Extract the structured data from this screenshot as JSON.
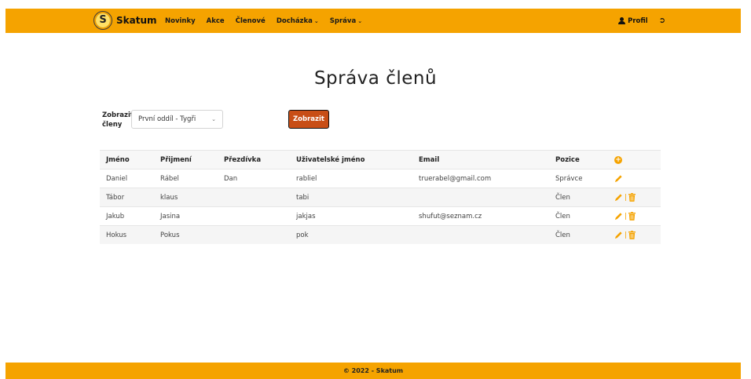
{
  "nav": {
    "brand_letter": "S",
    "brand_name": "Skatum",
    "links": [
      "Novinky",
      "Akce",
      "Členové"
    ],
    "dropdowns": [
      "Docházka",
      "Správa"
    ],
    "profile": "Profil"
  },
  "title": "Správa členů",
  "filter": {
    "label_line1": "Zobrazit",
    "label_line2": "členy",
    "selected": "První oddíl - Tygři",
    "button": "Zobrazit"
  },
  "table": {
    "headers": [
      "Jméno",
      "Přijmení",
      "Přezdívka",
      "Uživatelské jméno",
      "Email",
      "Pozice"
    ],
    "rows": [
      [
        "Daniel",
        "Rábel",
        "Dan",
        "rabliel",
        "truerabel@gmail.com",
        "Správce"
      ],
      [
        "Tábor",
        "klaus",
        "",
        "tabi",
        "",
        "Člen"
      ],
      [
        "Jakub",
        "Jasina",
        "",
        "jakjas",
        "shufut@seznam.cz",
        "Člen"
      ],
      [
        "Hokus",
        "Pokus",
        "",
        "pok",
        "",
        "Člen"
      ]
    ]
  },
  "colors": {
    "accent": "#f5a300",
    "button": "#c84e16"
  },
  "footer": "© 2022 - Skatum"
}
